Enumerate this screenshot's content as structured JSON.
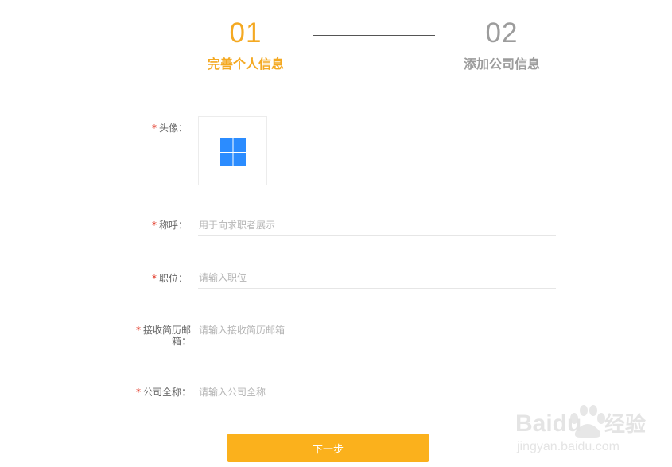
{
  "steps": [
    {
      "number": "01",
      "label": "完善个人信息",
      "state": "active"
    },
    {
      "number": "02",
      "label": "添加公司信息",
      "state": "inactive"
    }
  ],
  "colors": {
    "accent": "#f4a922",
    "button": "#fbb11c",
    "inactive": "#9c9c9c",
    "required": "#e0301e",
    "upload_icon": "#2b8cff"
  },
  "form": {
    "required_mark": "*",
    "avatar": {
      "label": "头像：",
      "icon": "upload-square-icon"
    },
    "nickname": {
      "label": "称呼：",
      "value": "",
      "placeholder": "用于向求职者展示"
    },
    "position": {
      "label": "职位：",
      "value": "",
      "placeholder": "请输入职位"
    },
    "resume_email": {
      "label_line1": "接收简历邮",
      "label_line2": "箱：",
      "value": "",
      "placeholder": "请输入接收简历邮箱"
    },
    "company_name": {
      "label": "公司全称：",
      "value": "",
      "placeholder": "请输入公司全称"
    },
    "next_button": "下一步"
  },
  "watermark": {
    "brand": "Baidu",
    "brand_cn": "经验",
    "url": "jingyan.baidu.com"
  }
}
